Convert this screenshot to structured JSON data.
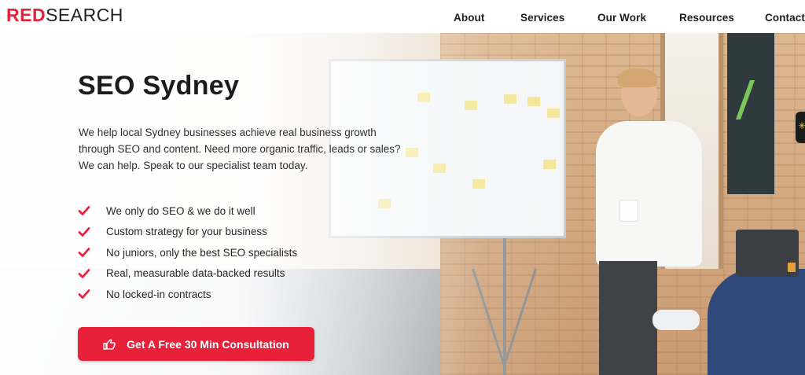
{
  "header": {
    "logo_red": "RED",
    "logo_dark": "SEARCH",
    "nav": [
      "About",
      "Services",
      "Our Work",
      "Resources",
      "Contact"
    ]
  },
  "hero": {
    "title": "SEO Sydney",
    "lead_lines": [
      "We help local Sydney businesses achieve real business growth",
      "through SEO and content. Need more organic traffic, leads or sales?",
      "We can help. Speak to our specialist team today."
    ],
    "benefits": [
      "We only do SEO & we do it well",
      "Custom strategy for your business",
      "No juniors, only the best SEO specialists",
      "Real, measurable data-backed results",
      "No locked-in contracts"
    ],
    "cta_label": "Get A Free 30 Min Consultation",
    "cta_icon": "hand-pointer-icon",
    "check_icon": "check-icon"
  },
  "colors": {
    "accent": "#e8203a",
    "text": "#1c1c1c"
  }
}
